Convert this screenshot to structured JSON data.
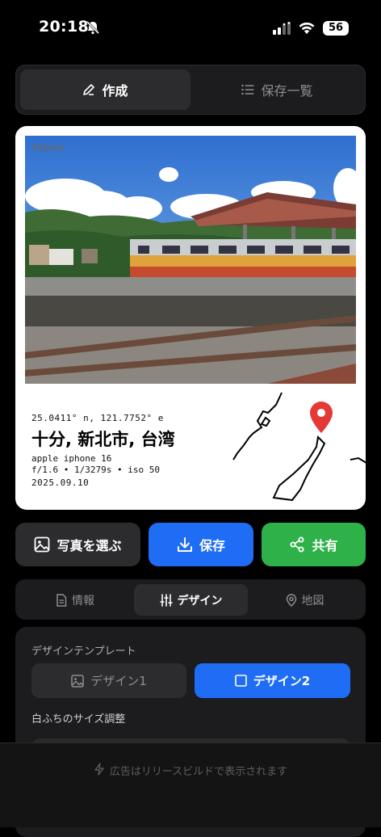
{
  "status_bar": {
    "time": "20:18",
    "battery": "56",
    "icons": [
      "bell-slash-icon",
      "signal-icon",
      "wifi-icon",
      "battery-icon"
    ]
  },
  "top_tabs": {
    "create": {
      "label": "作成",
      "icon": "pencil-icon"
    },
    "saved_list": {
      "label": "保存一覧",
      "icon": "list-icon"
    }
  },
  "card": {
    "brand": "Tabini",
    "coords": "25.0411° n, 121.7752° e",
    "place": "十分, 新北市, 台湾",
    "device_line1": "apple iphone 16",
    "device_line2": "f/1.6 • 1/3279s • iso 50",
    "date": "2025.09.10",
    "map_pin_color": "#e53935"
  },
  "actions": {
    "pick_photo": {
      "label": "写真を選ぶ",
      "icon": "image-icon"
    },
    "save": {
      "label": "保存",
      "icon": "download-icon",
      "color": "#1f6cf5"
    },
    "share": {
      "label": "共有",
      "icon": "share-icon",
      "color": "#2fb14a"
    }
  },
  "sub_tabs": {
    "info": {
      "label": "情報",
      "icon": "document-icon"
    },
    "design": {
      "label": "デザイン",
      "icon": "sliders-icon"
    },
    "map": {
      "label": "地図",
      "icon": "map-pin-icon"
    }
  },
  "design_panel": {
    "template_title": "デザインテンプレート",
    "design1": {
      "label": "デザイン1",
      "icon": "image-icon"
    },
    "design2": {
      "label": "デザイン2",
      "icon": "square-icon"
    },
    "border_title": "白ふちのサイズ調整"
  },
  "ad": {
    "text": "広告はリリースビルドで表示されます",
    "icon": "bolt-icon"
  }
}
